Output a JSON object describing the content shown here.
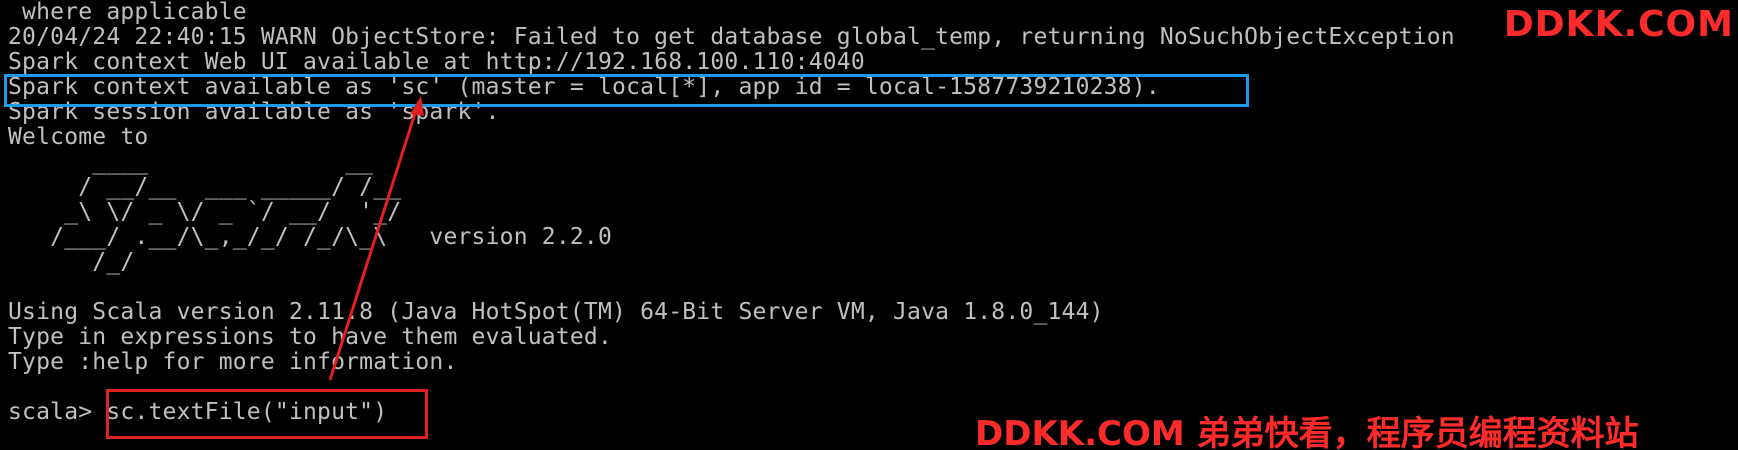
{
  "terminal": {
    "lines": [
      " where applicable",
      "20/04/24 22:40:15 WARN ObjectStore: Failed to get database global_temp, returning NoSuchObjectException",
      "Spark context Web UI available at http://192.168.100.110:4040",
      "Spark context available as 'sc' (master = local[*], app id = local-1587739210238).",
      "Spark session available as 'spark'.",
      "Welcome to",
      "      ____              __",
      "     / __/__  ___ _____/ /__",
      "    _\\ \\/ _ \\/ _ `/ __/  '_/",
      "   /___/ .__/\\_,_/_/ /_/\\_\\   version 2.2.0",
      "      /_/",
      "",
      "Using Scala version 2.11.8 (Java HotSpot(TM) 64-Bit Server VM, Java 1.8.0_144)",
      "Type in expressions to have them evaluated.",
      "Type :help for more information.",
      "",
      "scala> sc.textFile(\"input\")"
    ],
    "prompt": "scala>",
    "command": "sc.textFile(\"input\")"
  },
  "watermark": {
    "top": "DDKK.COM",
    "bottom": "DDKK.COM 弟弟快看，程序员编程资料站"
  },
  "colors": {
    "terminal_bg": "#000000",
    "terminal_text": "#c0c0c0",
    "highlight_blue": "#1e9be8",
    "highlight_red": "#e02020",
    "watermark_red": "#ff2b2b"
  }
}
